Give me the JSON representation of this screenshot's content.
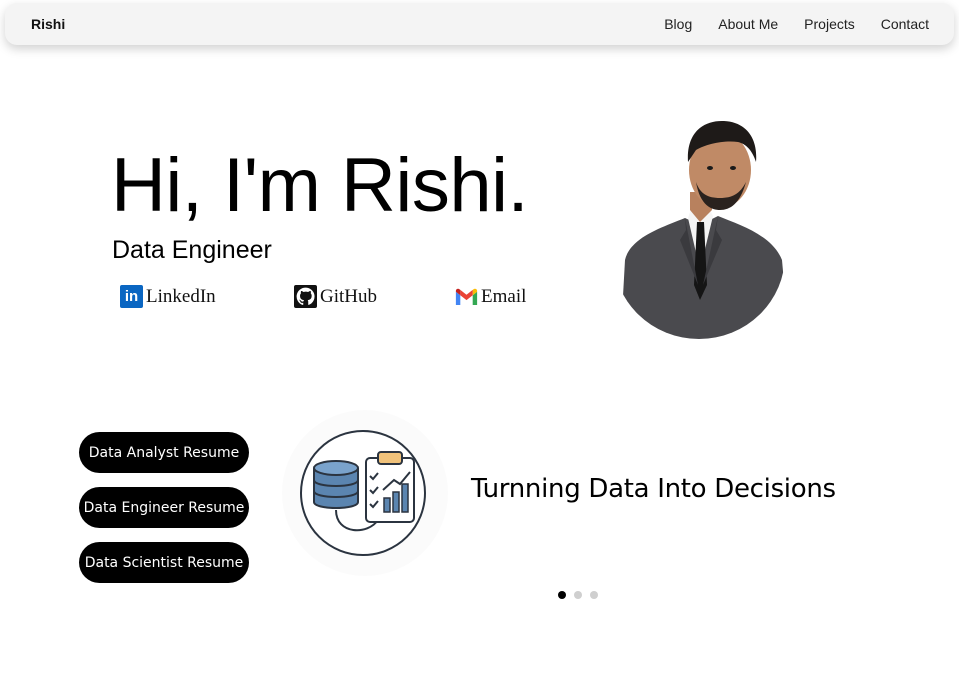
{
  "navbar": {
    "brand": "Rishi",
    "links": [
      "Blog",
      "About Me",
      "Projects",
      "Contact"
    ]
  },
  "hero": {
    "title": "Hi, I'm Rishi.",
    "subtitle": "Data Engineer",
    "social": [
      {
        "label": "LinkedIn",
        "icon": "linkedin-icon"
      },
      {
        "label": "GitHub",
        "icon": "github-icon"
      },
      {
        "label": "Email",
        "icon": "gmail-icon"
      }
    ]
  },
  "resumes": [
    "Data Analyst Resume",
    "Data Engineer Resume",
    "Data Scientist Resume"
  ],
  "carousel": {
    "text": "Turnning Data Into Decisions",
    "icon": "database-report-icon",
    "slide_count": 3,
    "active_slide": 1
  },
  "colors": {
    "linkedin": "#0a66c2",
    "button_bg": "#000000",
    "dot_active": "#000000",
    "dot_inactive": "#cfcfcf"
  }
}
